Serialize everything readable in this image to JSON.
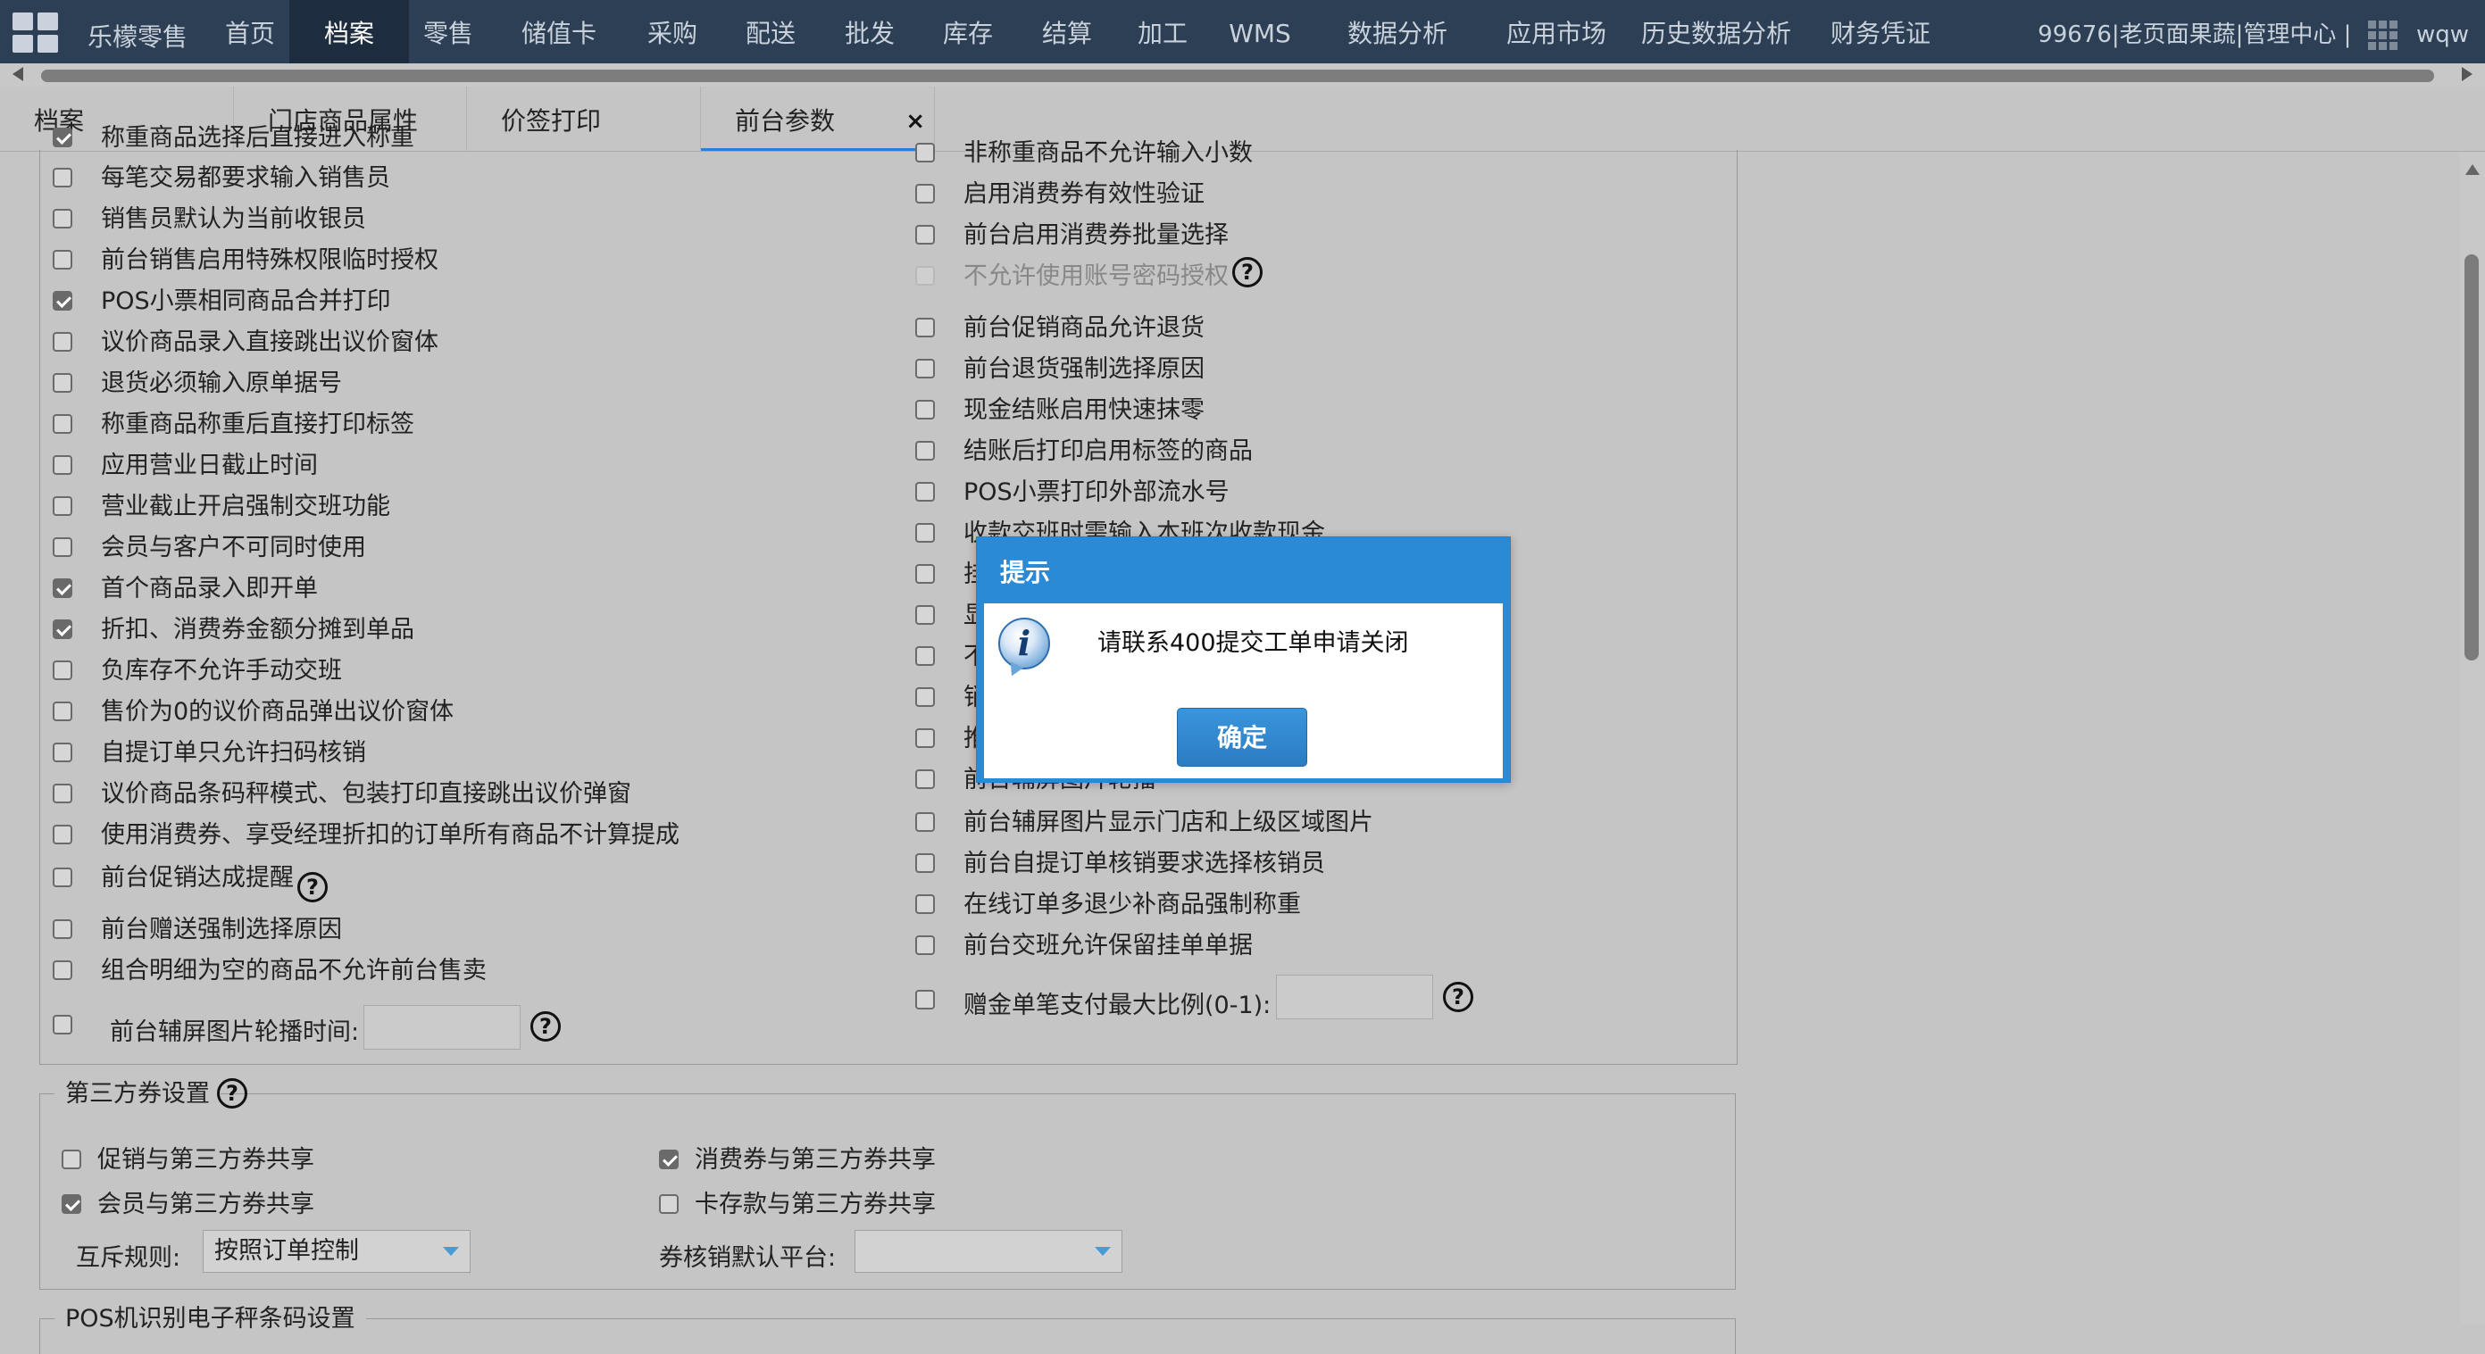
{
  "nav": {
    "brand": "乐檬零售",
    "items": [
      "首页",
      "档案",
      "零售",
      "储值卡",
      "采购",
      "配送",
      "批发",
      "库存",
      "结算",
      "加工",
      "WMS",
      "数据分析",
      "应用市场",
      "历史数据分析",
      "财务凭证"
    ],
    "active": "档案",
    "store_info": "99676|老页面果蔬|管理中心",
    "separator": "|",
    "user": "wqw"
  },
  "tabs": {
    "items": [
      "档案",
      "门店商品属性",
      "价签打印",
      "前台参数"
    ],
    "active": "前台参数",
    "close_glyph": "×"
  },
  "left_options": [
    {
      "label": "称重商品选择后直接进入称重",
      "checked": true
    },
    {
      "label": "每笔交易都要求输入销售员",
      "checked": false
    },
    {
      "label": "销售员默认为当前收银员",
      "checked": false
    },
    {
      "label": "前台销售启用特殊权限临时授权",
      "checked": false
    },
    {
      "label": "POS小票相同商品合并打印",
      "checked": true
    },
    {
      "label": "议价商品录入直接跳出议价窗体",
      "checked": false
    },
    {
      "label": "退货必须输入原单据号",
      "checked": false
    },
    {
      "label": "称重商品称重后直接打印标签",
      "checked": false
    },
    {
      "label": "应用营业日截止时间",
      "checked": false
    },
    {
      "label": "营业截止开启强制交班功能",
      "checked": false
    },
    {
      "label": "会员与客户不可同时使用",
      "checked": false
    },
    {
      "label": "首个商品录入即开单",
      "checked": true
    },
    {
      "label": "折扣、消费券金额分摊到单品",
      "checked": true
    },
    {
      "label": "负库存不允许手动交班",
      "checked": false
    },
    {
      "label": "售价为0的议价商品弹出议价窗体",
      "checked": false
    },
    {
      "label": "自提订单只允许扫码核销",
      "checked": false
    },
    {
      "label": "议价商品条码秤模式、包装打印直接跳出议价弹窗",
      "checked": false
    },
    {
      "label": "使用消费券、享受经理折扣的订单所有商品不计算提成",
      "checked": false
    },
    {
      "label": "前台促销达成提醒",
      "checked": false
    },
    {
      "label": "前台赠送强制选择原因",
      "checked": false
    },
    {
      "label": "组合明细为空的商品不允许前台售卖",
      "checked": false
    }
  ],
  "left_input_label": "前台辅屏图片轮播时间:",
  "right_options": [
    {
      "label": "非称重商品不允许输入小数",
      "checked": false
    },
    {
      "label": "启用消费券有效性验证",
      "checked": false
    },
    {
      "label": "前台启用消费券批量选择",
      "checked": false
    },
    {
      "label": "不允许使用账号密码授权",
      "checked": false,
      "disabled": true
    },
    {
      "label": "前台促销商品允许退货",
      "checked": false
    },
    {
      "label": "前台退货强制选择原因",
      "checked": false
    },
    {
      "label": "现金结账启用快速抹零",
      "checked": false
    },
    {
      "label": "结账后打印启用标签的商品",
      "checked": false
    },
    {
      "label": "POS小票打印外部流水号",
      "checked": false
    },
    {
      "label": "收款交班时需输入本班次收款现金",
      "checked": false
    },
    {
      "label": "挂",
      "checked": false
    },
    {
      "label": "显",
      "checked": false
    },
    {
      "label": "不",
      "checked": false
    },
    {
      "label": "销",
      "checked": false
    },
    {
      "label": "推",
      "checked": false
    },
    {
      "label": "前台辅屏图片轮播",
      "checked": false
    },
    {
      "label": "前台辅屏图片显示门店和上级区域图片",
      "checked": false
    },
    {
      "label": "前台自提订单核销要求选择核销员",
      "checked": false
    },
    {
      "label": "在线订单多退少补商品强制称重",
      "checked": false
    },
    {
      "label": "前台交班允许保留挂单单据",
      "checked": false
    }
  ],
  "right_input_label": "赠金单笔支付最大比例(0-1):",
  "third_party": {
    "legend": "第三方券设置",
    "options": [
      {
        "label": "促销与第三方券共享",
        "checked": false
      },
      {
        "label": "消费券与第三方券共享",
        "checked": true
      },
      {
        "label": "会员与第三方券共享",
        "checked": true
      },
      {
        "label": "卡存款与第三方券共享",
        "checked": false
      }
    ],
    "mutex_label": "互斥规则:",
    "mutex_value": "按照订单控制",
    "platform_label": "券核销默认平台:",
    "platform_value": ""
  },
  "next_section_legend": "POS机识别电子秤条码设置",
  "help_glyph": "?",
  "dialog": {
    "title": "提示",
    "message": "请联系400提交工单申请关闭",
    "ok_label": "确定",
    "icon_glyph": "i"
  },
  "colors": {
    "nav_bg": "#2d3f55",
    "nav_active_bg": "#1d2c3e",
    "page_bg": "#c5c5c5",
    "accent": "#2b8ad6"
  }
}
